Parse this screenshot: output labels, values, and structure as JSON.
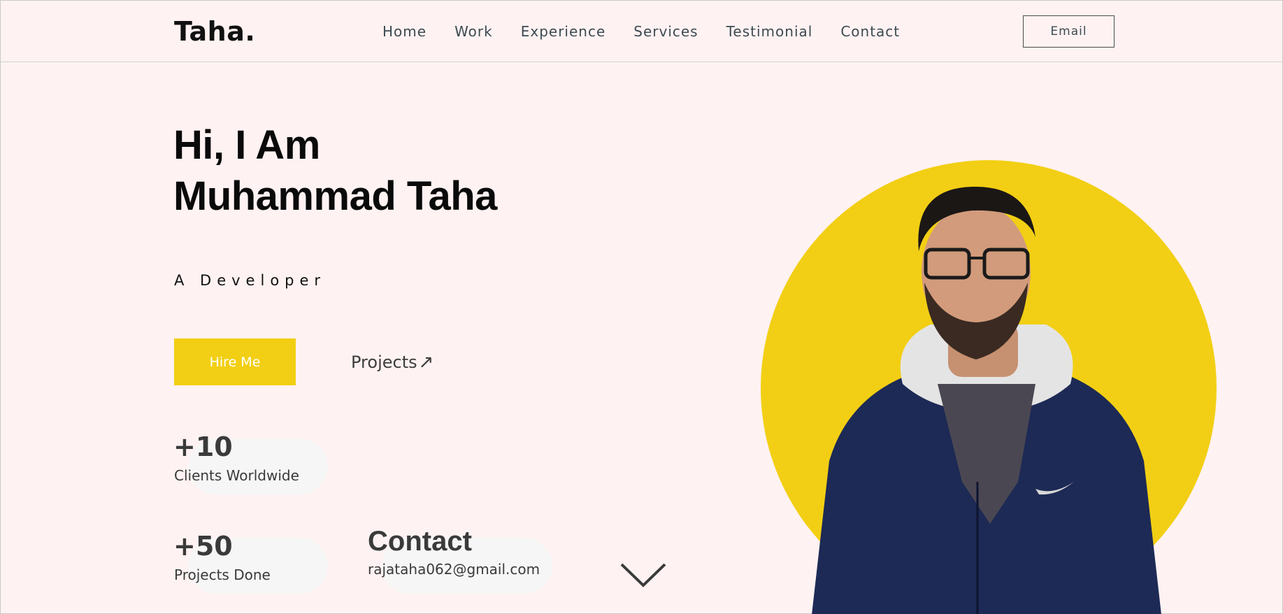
{
  "header": {
    "logo": "Taha.",
    "nav": [
      "Home",
      "Work",
      "Experience",
      "Services",
      "Testimonial",
      "Contact"
    ],
    "email_button": "Email"
  },
  "hero": {
    "greeting": "Hi, I Am",
    "name": "Muhammad Taha",
    "role": "A Developer",
    "hire_button": "Hire Me",
    "projects_link": "Projects",
    "projects_arrow": "↗"
  },
  "stats": [
    {
      "value": "+10",
      "label": "Clients Worldwide"
    },
    {
      "value": "+50",
      "label": "Projects Done"
    }
  ],
  "contact": {
    "title": "Contact",
    "email": "rajataha062@gmail.com"
  },
  "colors": {
    "background": "#fff2f2",
    "accent": "#f2cf14",
    "text_dark": "#0a0a0a",
    "nav_text": "#3d4a52",
    "hoodie": "#1d2a55"
  },
  "icons": {
    "scroll": "chevron-down-icon"
  }
}
